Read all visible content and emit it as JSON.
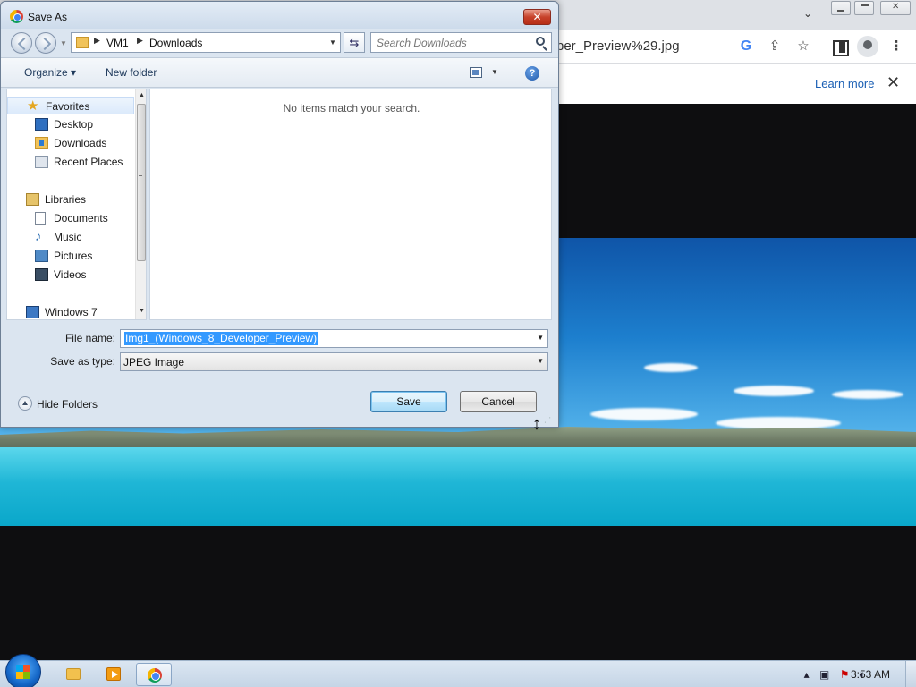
{
  "browser": {
    "url_text": "per_Preview%29.jpg",
    "infobar": {
      "learn_more": "Learn more"
    }
  },
  "dialog": {
    "title": "Save As",
    "breadcrumb": [
      "VM1",
      "Downloads"
    ],
    "search_placeholder": "Search Downloads",
    "toolbar": {
      "organize": "Organize ▾",
      "new_folder": "New folder"
    },
    "nav_tree": [
      {
        "label": "Favorites",
        "icon": "favorites-star-icon",
        "level": "head"
      },
      {
        "label": "Desktop",
        "icon": "desktop-icon",
        "level": "sub"
      },
      {
        "label": "Downloads",
        "icon": "downloads-folder-icon",
        "level": "sub"
      },
      {
        "label": "Recent Places",
        "icon": "recent-places-icon",
        "level": "sub"
      },
      {
        "label": "Libraries",
        "icon": "libraries-icon",
        "level": "head"
      },
      {
        "label": "Documents",
        "icon": "documents-icon",
        "level": "sub"
      },
      {
        "label": "Music",
        "icon": "music-icon",
        "level": "sub"
      },
      {
        "label": "Pictures",
        "icon": "pictures-icon",
        "level": "sub"
      },
      {
        "label": "Videos",
        "icon": "videos-icon",
        "level": "sub"
      },
      {
        "label": "Windows 7",
        "icon": "computer-icon",
        "level": "head"
      }
    ],
    "empty_message": "No items match your search.",
    "file_name_label": "File name:",
    "file_name_value": "Img1_(Windows_8_Developer_Preview)",
    "save_type_label": "Save as type:",
    "save_type_value": "JPEG Image",
    "hide_folders": "Hide Folders",
    "save_button": "Save",
    "cancel_button": "Cancel"
  },
  "taskbar": {
    "clock": "3:53 AM"
  },
  "colors": {
    "selection": "#3399ff",
    "dialog_bg": "#dbe5f0",
    "link": "#1a5fb4"
  }
}
